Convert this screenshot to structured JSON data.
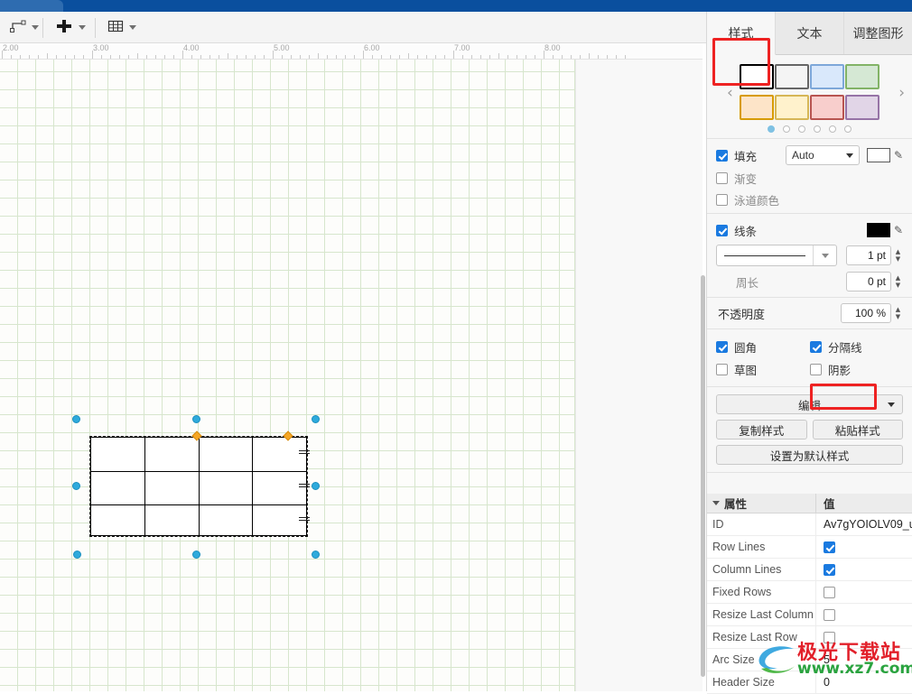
{
  "titlebar": {
    "name": "window-title-bar"
  },
  "toolbar": {
    "waypoint_label": "waypoint-icon",
    "insert_label": "plus-icon",
    "table_label": "table-icon",
    "fullscreen_label": "fullscreen-icon",
    "panel_label": "toggle-panel-icon"
  },
  "ruler": {
    "labels": [
      "2.00",
      "3.00",
      "4.00",
      "5.00",
      "6.00",
      "7.00",
      "8.00"
    ]
  },
  "canvas": {
    "shape": {
      "type": "table",
      "rows": 3,
      "columns": 4,
      "selected": true
    }
  },
  "panel": {
    "tabs": [
      {
        "label": "样式",
        "active": true,
        "highlighted": true
      },
      {
        "label": "文本",
        "active": false,
        "highlighted": false
      },
      {
        "label": "调整图形",
        "active": false,
        "highlighted": false
      }
    ],
    "swatches": {
      "row1": [
        {
          "fill": "#ffffff",
          "stroke": "#000000"
        },
        {
          "fill": "#f4f4f4",
          "stroke": "#666666"
        },
        {
          "fill": "#d9e8fb",
          "stroke": "#7da7d9"
        },
        {
          "fill": "#d5e8d4",
          "stroke": "#82b366"
        }
      ],
      "row2": [
        {
          "fill": "#fde4c8",
          "stroke": "#d79b00"
        },
        {
          "fill": "#fff2cc",
          "stroke": "#d6b656"
        },
        {
          "fill": "#f8cecc",
          "stroke": "#b85450"
        },
        {
          "fill": "#e1d5e7",
          "stroke": "#9673a6"
        }
      ],
      "page_count": 6,
      "active_page": 1,
      "prev_label": "‹",
      "next_label": "›"
    },
    "fill": {
      "label": "填充",
      "checked": true,
      "select_value": "Auto",
      "color": "#ffffff",
      "picker_label": "eyedropper-icon"
    },
    "gradient": {
      "label": "渐变",
      "checked": false
    },
    "swimlane_color": {
      "label": "泳道颜色",
      "checked": false
    },
    "line": {
      "label": "线条",
      "checked": true,
      "color": "#000000",
      "picker_label": "eyedropper-icon",
      "width_value": "1 pt",
      "perimeter_label": "周长",
      "perimeter_value": "0 pt"
    },
    "opacity": {
      "label": "不透明度",
      "value": "100 %"
    },
    "toggles": [
      {
        "label": "圆角",
        "checked": true,
        "highlighted": false
      },
      {
        "label": "分隔线",
        "checked": true,
        "highlighted": false
      },
      {
        "label": "草图",
        "checked": false,
        "highlighted": false
      },
      {
        "label": "阴影",
        "checked": false,
        "highlighted": true
      }
    ],
    "buttons": {
      "edit": "编辑",
      "copy_style": "复制样式",
      "paste_style": "粘贴样式",
      "set_default": "设置为默认样式"
    },
    "properties": {
      "header": {
        "name": "属性",
        "value": "值"
      },
      "rows": [
        {
          "name": "ID",
          "value": "Av7gYOIOLV09_u",
          "type": "text"
        },
        {
          "name": "Row Lines",
          "value": "",
          "type": "checkbox",
          "checked": true
        },
        {
          "name": "Column Lines",
          "value": "",
          "type": "checkbox",
          "checked": true
        },
        {
          "name": "Fixed Rows",
          "value": "",
          "type": "checkbox",
          "checked": false
        },
        {
          "name": "Resize Last Column",
          "value": "",
          "type": "checkbox",
          "checked": false
        },
        {
          "name": "Resize Last Row",
          "value": "",
          "type": "checkbox",
          "checked": false
        },
        {
          "name": "Arc Size",
          "value": "5",
          "type": "text"
        },
        {
          "name": "Header Size",
          "value": "0",
          "type": "text"
        }
      ]
    }
  },
  "watermark": {
    "top": "极光下载站",
    "bottom": "www.xz7.com"
  }
}
